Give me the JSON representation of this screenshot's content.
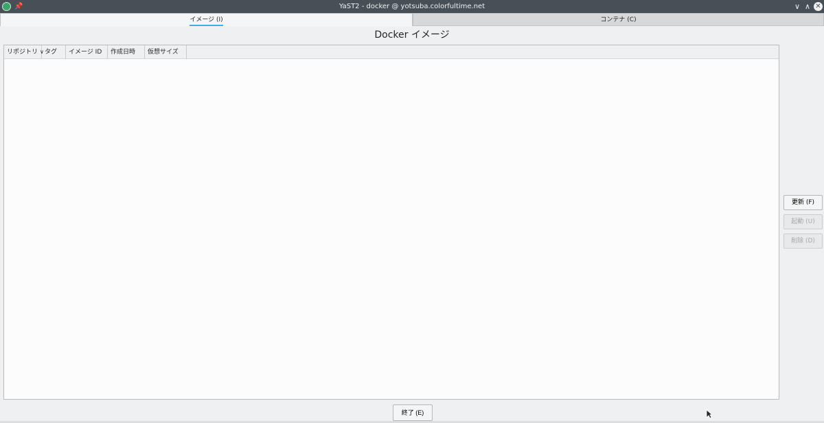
{
  "window": {
    "title": "YaST2 - docker @ yotsuba.colorfultime.net",
    "pin_glyph": "📌",
    "minimize_glyph": "∨",
    "maximize_glyph": "∧",
    "close_glyph": "✕"
  },
  "tabs": [
    {
      "label": "イメージ (I)",
      "active": true
    },
    {
      "label": "コンテナ (C)",
      "active": false
    }
  ],
  "heading": "Docker イメージ",
  "table": {
    "columns": [
      {
        "label": "リポジトリ",
        "sort_glyph": "∨"
      },
      {
        "label": "タグ"
      },
      {
        "label": "イメージ ID"
      },
      {
        "label": "作成日時"
      },
      {
        "label": "仮想サイズ"
      }
    ],
    "rows": []
  },
  "actions": {
    "refresh": {
      "label": "更新 (F)",
      "enabled": true
    },
    "start": {
      "label": "起動 (U)",
      "enabled": false
    },
    "delete": {
      "label": "削除 (D)",
      "enabled": false
    }
  },
  "footer": {
    "quit_label": "終了 (E)"
  },
  "colors": {
    "titlebar": "#475057",
    "accent": "#3daee9",
    "background": "#eff0f1"
  }
}
